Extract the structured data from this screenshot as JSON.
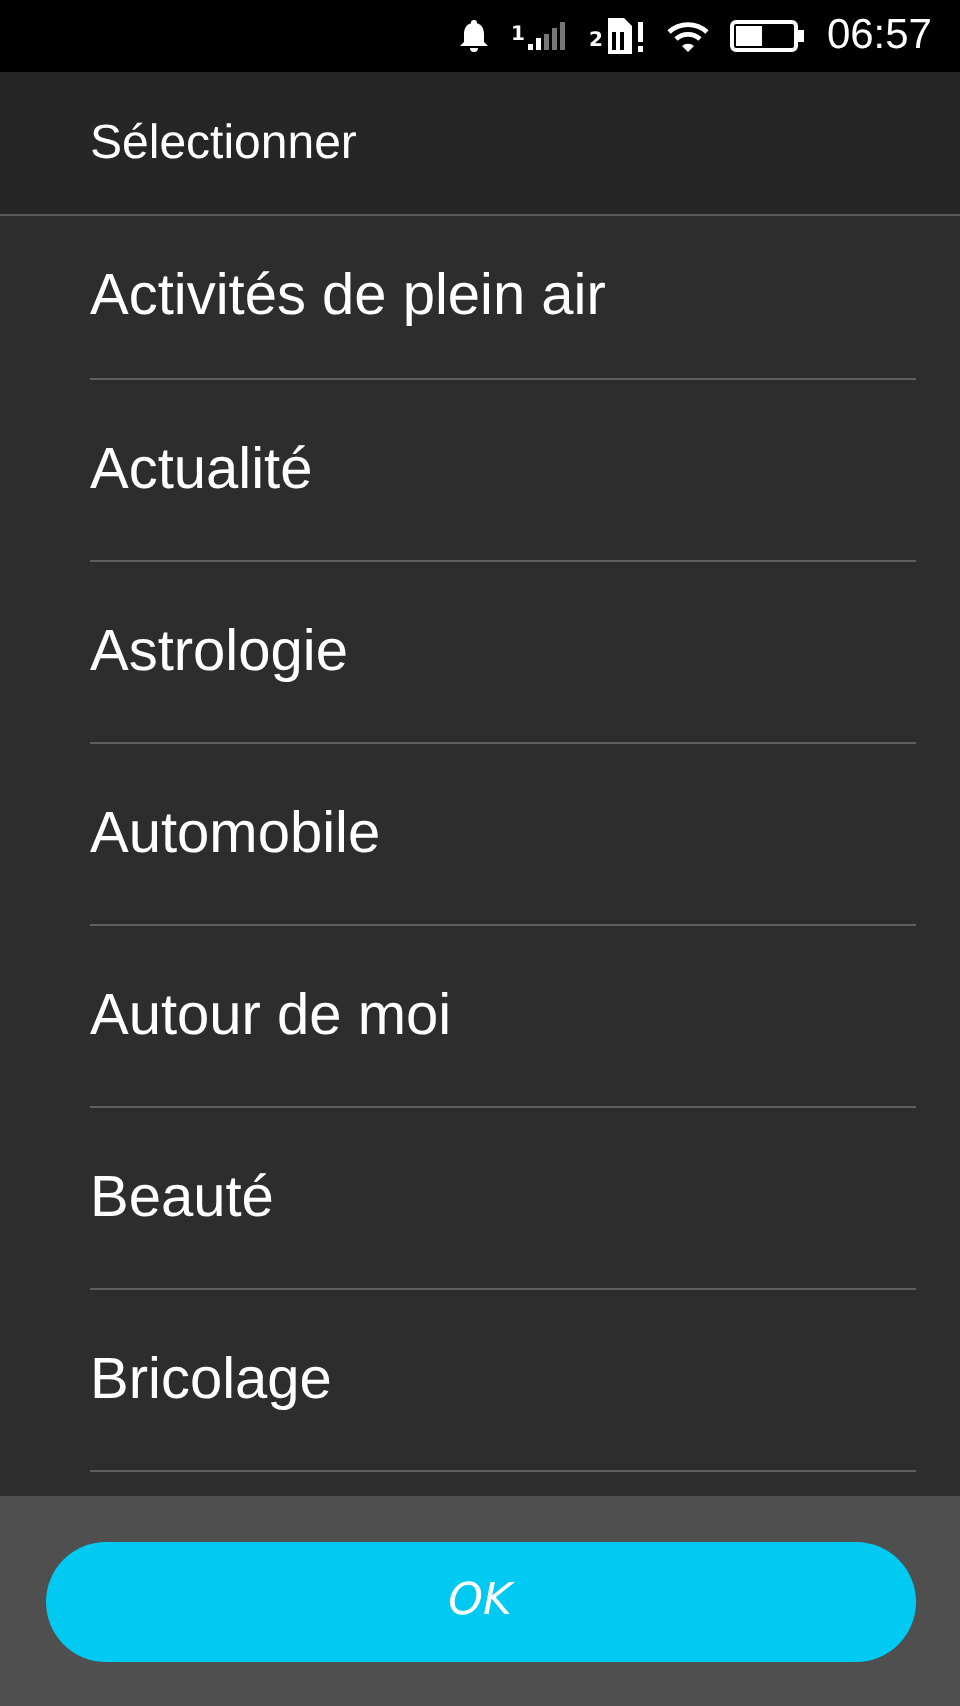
{
  "status_bar": {
    "sim1": "1",
    "sim2": "2",
    "time": "06:57"
  },
  "header": {
    "title": "Sélectionner"
  },
  "options": [
    {
      "label": "Activités de plein air"
    },
    {
      "label": "Actualité"
    },
    {
      "label": "Astrologie"
    },
    {
      "label": "Automobile"
    },
    {
      "label": "Autour de moi"
    },
    {
      "label": "Beauté"
    },
    {
      "label": "Bricolage"
    }
  ],
  "buttons": [
    {
      "label": "OK"
    }
  ]
}
